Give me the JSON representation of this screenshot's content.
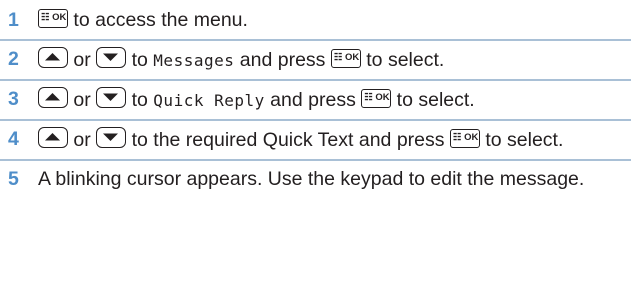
{
  "steps": [
    {
      "number": "1",
      "segments": [
        {
          "type": "key",
          "icon": "ok-key-icon",
          "glyph": "☷ OK"
        },
        {
          "type": "text",
          "value": " to access the menu."
        }
      ]
    },
    {
      "number": "2",
      "segments": [
        {
          "type": "key",
          "icon": "up-arrow-key-icon"
        },
        {
          "type": "text",
          "value": " or "
        },
        {
          "type": "key",
          "icon": "down-arrow-key-icon"
        },
        {
          "type": "text",
          "value": " to "
        },
        {
          "type": "mono",
          "value": "Messages"
        },
        {
          "type": "text",
          "value": " and press "
        },
        {
          "type": "key",
          "icon": "ok-key-icon",
          "glyph": "☷ OK"
        },
        {
          "type": "text",
          "value": " to select."
        }
      ]
    },
    {
      "number": "3",
      "segments": [
        {
          "type": "key",
          "icon": "up-arrow-key-icon"
        },
        {
          "type": "text",
          "value": " or "
        },
        {
          "type": "key",
          "icon": "down-arrow-key-icon"
        },
        {
          "type": "text",
          "value": " to "
        },
        {
          "type": "mono",
          "value": "Quick Reply"
        },
        {
          "type": "text",
          "value": " and press "
        },
        {
          "type": "key",
          "icon": "ok-key-icon",
          "glyph": "☷ OK"
        },
        {
          "type": "text",
          "value": " to select."
        }
      ]
    },
    {
      "number": "4",
      "segments": [
        {
          "type": "key",
          "icon": "up-arrow-key-icon"
        },
        {
          "type": "text",
          "value": " or "
        },
        {
          "type": "key",
          "icon": "down-arrow-key-icon"
        },
        {
          "type": "text",
          "value": " to the required Quick Text and press "
        },
        {
          "type": "key",
          "icon": "ok-key-icon",
          "glyph": "☷ OK"
        },
        {
          "type": "text",
          "value": " to select."
        }
      ]
    },
    {
      "number": "5",
      "segments": [
        {
          "type": "text",
          "value": "A blinking cursor appears. Use the keypad to edit the message."
        }
      ]
    }
  ],
  "colors": {
    "step_number": "#4f8ec9",
    "divider": "#a9c0d6",
    "text": "#231f20"
  }
}
